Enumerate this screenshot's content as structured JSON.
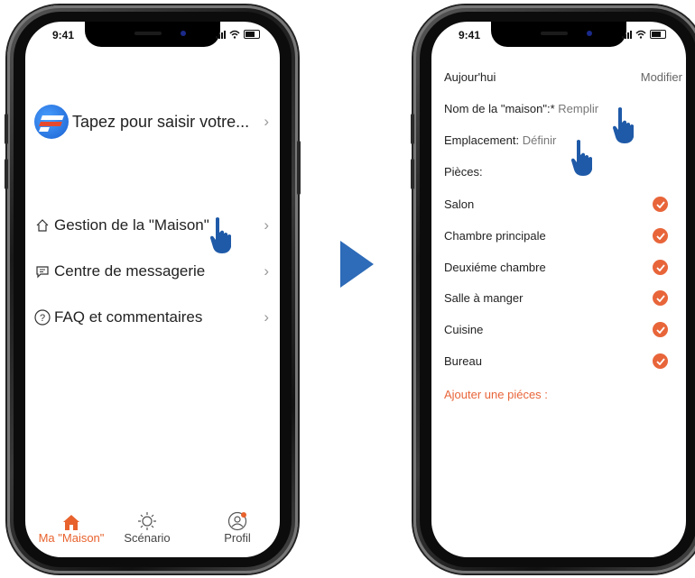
{
  "status": {
    "time": "9:41"
  },
  "home_screen": {
    "profile_prompt": "Tapez pour saisir votre...",
    "profile_logo": "brand-logo-icon",
    "menu": [
      {
        "icon": "house-icon",
        "label": "Gestion de la \"Maison\""
      },
      {
        "icon": "message-icon",
        "label": "Centre de messagerie"
      },
      {
        "icon": "help-icon",
        "label": "FAQ et commentaires"
      }
    ],
    "tabs": [
      {
        "icon": "home-icon",
        "label": "Ma \"Maison\"",
        "active": true
      },
      {
        "icon": "sun-icon",
        "label": "Scénario",
        "active": false
      },
      {
        "icon": "profile-icon",
        "label": "Profil",
        "active": false
      }
    ]
  },
  "home_settings": {
    "title": "Aujour'hui",
    "edit": "Modifier",
    "name_label": "Nom de la \"maison\":*",
    "name_action": "Remplir",
    "location_label": "Emplacement:",
    "location_action": "Définir",
    "rooms_label": "Pièces:",
    "rooms": [
      "Salon",
      "Chambre principale",
      "Deuxiéme chambre",
      "Salle à manger",
      "Cuisine",
      "Bureau"
    ],
    "add_rooms": "Ajouter une piéces :"
  },
  "colors": {
    "accent": "#e8653a",
    "arrow": "#2e6bb8",
    "hand": "#1f5aa8"
  }
}
